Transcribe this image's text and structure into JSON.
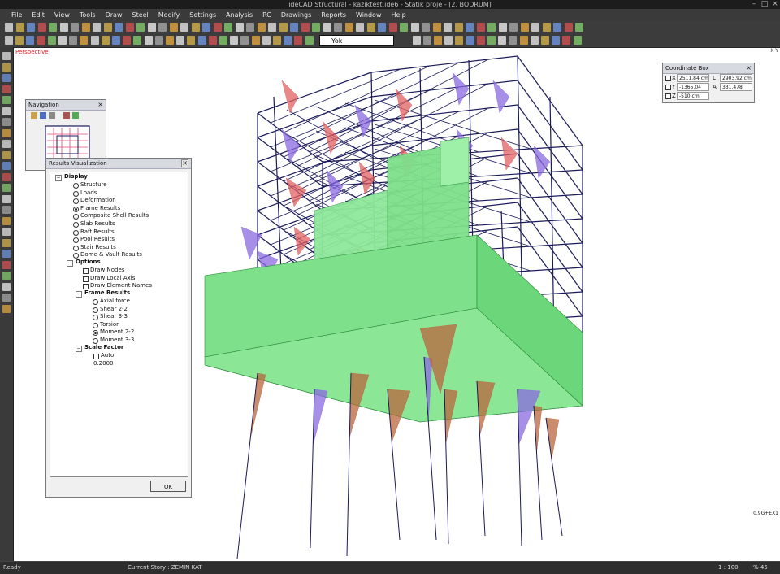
{
  "window": {
    "title": "ideCAD Structural - kaziktest.ide6 - Statik proje - [2. BODRUM]",
    "controls": [
      "–",
      "□",
      "×"
    ]
  },
  "menu": [
    "File",
    "Edit",
    "View",
    "Tools",
    "Draw",
    "Steel",
    "Modify",
    "Settings",
    "Analysis",
    "RC",
    "Drawings",
    "Reports",
    "Window",
    "Help"
  ],
  "toolbar": {
    "layer_select": "Yok"
  },
  "viewport": {
    "view_label": "Perspective",
    "load_case_label": "0.9G+EX1",
    "axes_label": "X  Y"
  },
  "navigation": {
    "title": "Navigation"
  },
  "results_visualization": {
    "title": "Results Visualization",
    "display_header": "Display",
    "display_items": [
      {
        "label": "Structure",
        "selected": false
      },
      {
        "label": "Loads",
        "selected": false
      },
      {
        "label": "Deformation",
        "selected": false
      },
      {
        "label": "Frame Results",
        "selected": true
      },
      {
        "label": "Composite Shell Results",
        "selected": false
      },
      {
        "label": "Slab Results",
        "selected": false
      },
      {
        "label": "Raft Results",
        "selected": false
      },
      {
        "label": "Pool Results",
        "selected": false
      },
      {
        "label": "Stair Results",
        "selected": false
      },
      {
        "label": "Dome & Vault Results",
        "selected": false
      }
    ],
    "options_header": "Options",
    "option_items": [
      {
        "label": "Draw Nodes",
        "checked": false
      },
      {
        "label": "Draw Local Axis",
        "checked": false
      },
      {
        "label": "Draw Element Names",
        "checked": false
      }
    ],
    "frame_results_header": "Frame Results",
    "frame_result_items": [
      {
        "label": "Axial force",
        "selected": false
      },
      {
        "label": "Shear 2-2",
        "selected": false
      },
      {
        "label": "Shear 3-3",
        "selected": false
      },
      {
        "label": "Torsion",
        "selected": false
      },
      {
        "label": "Moment 2-2",
        "selected": true
      },
      {
        "label": "Moment 3-3",
        "selected": false
      }
    ],
    "scale_factor_header": "Scale Factor",
    "scale_auto_label": "Auto",
    "scale_value": "0.2000",
    "ok_label": "OK"
  },
  "coordinate_box": {
    "title": "Coordinate Box",
    "x_label": "X",
    "x_value": "2511.84 cm",
    "y_label": "Y",
    "y_value": "-1365.04 cm",
    "z_label": "Z",
    "z_value": "-510 cm",
    "l_label": "L",
    "l_value": "2903.92 cm",
    "a_label": "A",
    "a_value": "331.478"
  },
  "statusbar": {
    "ready": "Ready",
    "current_story": "Current Story : ZEMIN KAT",
    "scale": "1 : 100",
    "zoom": "% 45"
  },
  "colors": {
    "shell_green": "#7ee08a",
    "moment_red": "#e06060",
    "moment_purple": "#8a6ae0",
    "frame_navy": "#1a1a5a",
    "pile_brown": "#b8663c"
  }
}
